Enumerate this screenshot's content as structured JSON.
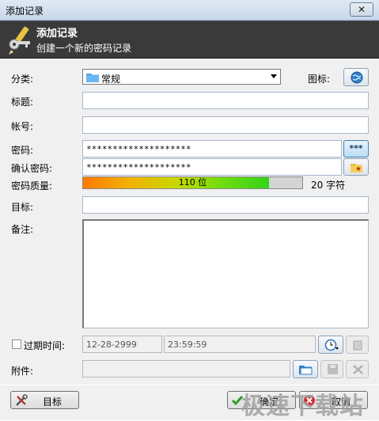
{
  "window": {
    "title": "添加记录",
    "close_glyph": "✕"
  },
  "header": {
    "title": "添加记录",
    "subtitle": "创建一个新的密码记录"
  },
  "form": {
    "category_label": "分类:",
    "category_value": "常规",
    "icon_label": "图标:",
    "title_label": "标题:",
    "title_value": "",
    "account_label": "帐号:",
    "account_value": "",
    "password_label": "密码:",
    "password_value": "********************",
    "show_password_glyph": "***",
    "confirm_label": "确认密码:",
    "confirm_value": "********************",
    "quality_label": "密码质量:",
    "quality_text": "110 位",
    "quality_fraction": 0.85,
    "char_count": "20 字符",
    "target_label": "目标:",
    "target_value": "",
    "notes_label": "备注:",
    "notes_value": "",
    "expire_label": "过期时间:",
    "expire_date": "12-28-2999",
    "expire_time": "23:59:59",
    "attachment_label": "附件:"
  },
  "buttons": {
    "tools": "目标",
    "ok": "确定",
    "cancel": "取消"
  },
  "watermark": "极速下载站",
  "colors": {
    "header_bg": "#3a3a3a",
    "accent_blue": "#3c7fb1"
  }
}
